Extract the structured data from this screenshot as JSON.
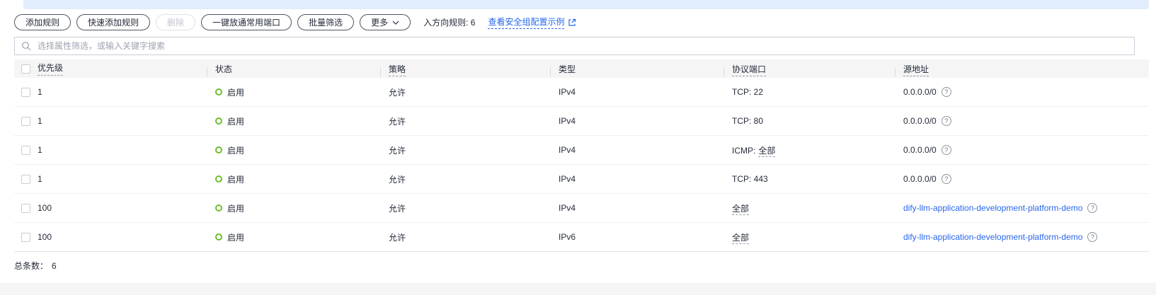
{
  "toolbar": {
    "add_rule": "添加规则",
    "quick_add_rule": "快速添加规则",
    "delete": "删除",
    "open_common_ports": "一键放通常用端口",
    "batch_filter": "批量筛选",
    "more": "更多",
    "inbound_label": "入方向规则: 6",
    "view_example_link": "查看安全组配置示例"
  },
  "search": {
    "placeholder": "选择属性筛选，或输入关键字搜索"
  },
  "table": {
    "columns": [
      {
        "label": "优先级"
      },
      {
        "label": "状态"
      },
      {
        "label": "策略"
      },
      {
        "label": "类型"
      },
      {
        "label": "协议端口"
      },
      {
        "label": "源地址"
      }
    ],
    "rows": [
      {
        "priority": "1",
        "status": "启用",
        "policy": "允许",
        "type": "IPv4",
        "protocol": "TCP: 22",
        "protocol_tip": "",
        "source": "0.0.0.0/0",
        "source_is_link": false
      },
      {
        "priority": "1",
        "status": "启用",
        "policy": "允许",
        "type": "IPv4",
        "protocol": "TCP: 80",
        "protocol_tip": "",
        "source": "0.0.0.0/0",
        "source_is_link": false
      },
      {
        "priority": "1",
        "status": "启用",
        "policy": "允许",
        "type": "IPv4",
        "protocol": "ICMP:",
        "protocol_tip": "全部",
        "source": "0.0.0.0/0",
        "source_is_link": false
      },
      {
        "priority": "1",
        "status": "启用",
        "policy": "允许",
        "type": "IPv4",
        "protocol": "TCP: 443",
        "protocol_tip": "",
        "source": "0.0.0.0/0",
        "source_is_link": false
      },
      {
        "priority": "100",
        "status": "启用",
        "policy": "允许",
        "type": "IPv4",
        "protocol": "",
        "protocol_tip": "全部",
        "source": "dify-llm-application-development-platform-demo",
        "source_is_link": true
      },
      {
        "priority": "100",
        "status": "启用",
        "policy": "允许",
        "type": "IPv6",
        "protocol": "",
        "protocol_tip": "全部",
        "source": "dify-llm-application-development-platform-demo",
        "source_is_link": true
      }
    ]
  },
  "footer": {
    "total_label": "总条数：",
    "total_value": "6"
  },
  "icons": {
    "search": "search-icon",
    "chevron": "chevron-down-icon",
    "external": "external-link-icon",
    "help": "help-icon"
  },
  "colors": {
    "accent_blue": "#2767ee",
    "status_green": "#6fbe2d",
    "banner_blue": "#e1edfc",
    "header_bg": "#f5f5f6"
  }
}
